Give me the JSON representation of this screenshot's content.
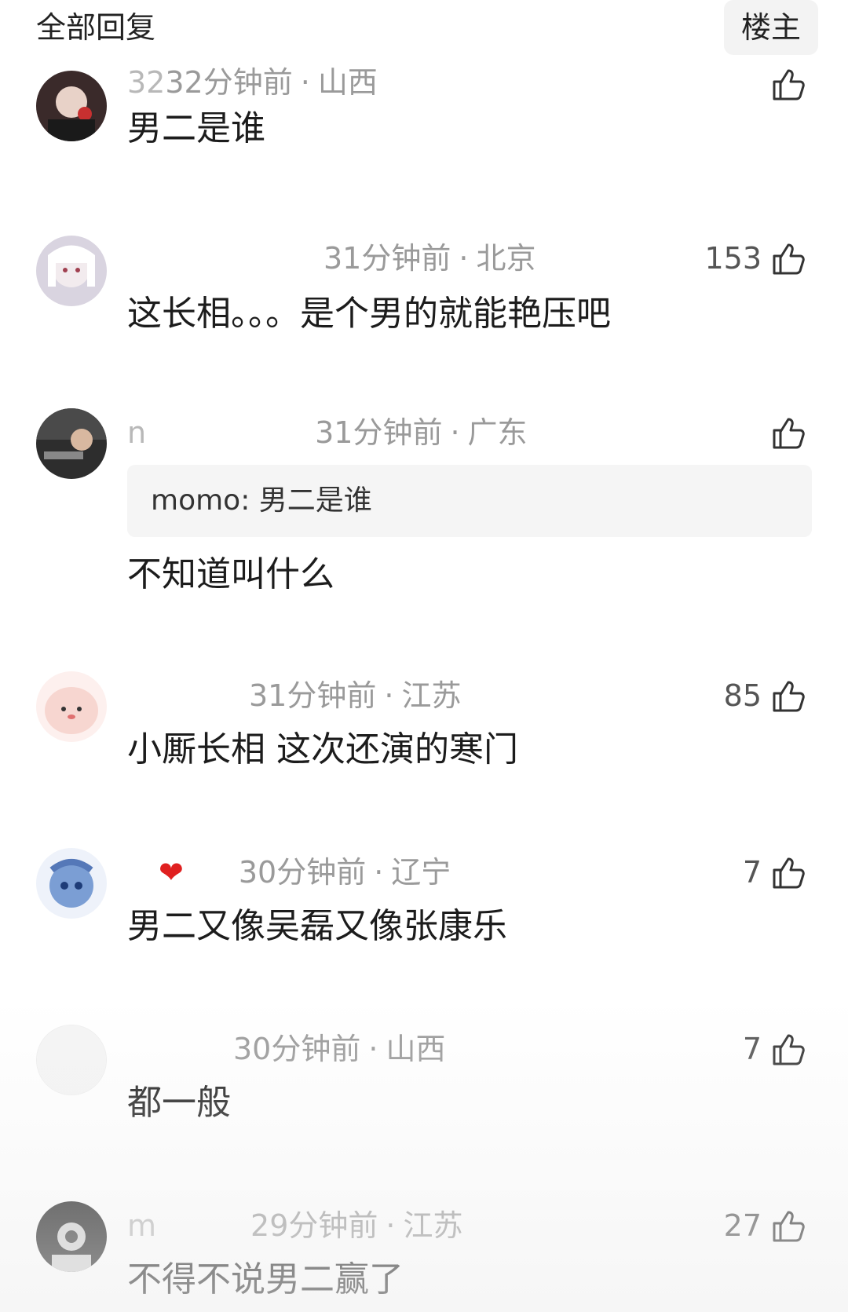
{
  "header": {
    "title": "全部回复",
    "owner_button": "楼主"
  },
  "comments": [
    {
      "user": "32",
      "time": "32分钟前",
      "location": "山西",
      "likes": "",
      "text": "男二是谁",
      "avatar_color": "#3a2a2a"
    },
    {
      "user": "",
      "time": "31分钟前",
      "location": "北京",
      "likes": "153",
      "text": "这长相。。。是个男的就能艳压吧",
      "avatar_color": "#d9d4e0"
    },
    {
      "user": "n",
      "time": "31分钟前",
      "location": "广东",
      "likes": "",
      "quote": "momo: 男二是谁",
      "text": "不知道叫什么",
      "avatar_color": "#2d2d2d"
    },
    {
      "user": "",
      "time": "31分钟前",
      "location": "江苏",
      "likes": "85",
      "text": "小厮长相 这次还演的寒门",
      "avatar_color": "#f7d6d0"
    },
    {
      "user": "",
      "time": "30分钟前",
      "location": "辽宁",
      "likes": "7",
      "text": "男二又像吴磊又像张康乐",
      "avatar_color": "#7b9ed4"
    },
    {
      "user": "",
      "time": "30分钟前",
      "location": "山西",
      "likes": "7",
      "text": "都一般",
      "avatar_color": "#f4f4f4"
    },
    {
      "user": "m",
      "time": "29分钟前",
      "location": "江苏",
      "likes": "27",
      "text": "不得不说男二赢了",
      "avatar_color": "#1e1e1e"
    }
  ]
}
